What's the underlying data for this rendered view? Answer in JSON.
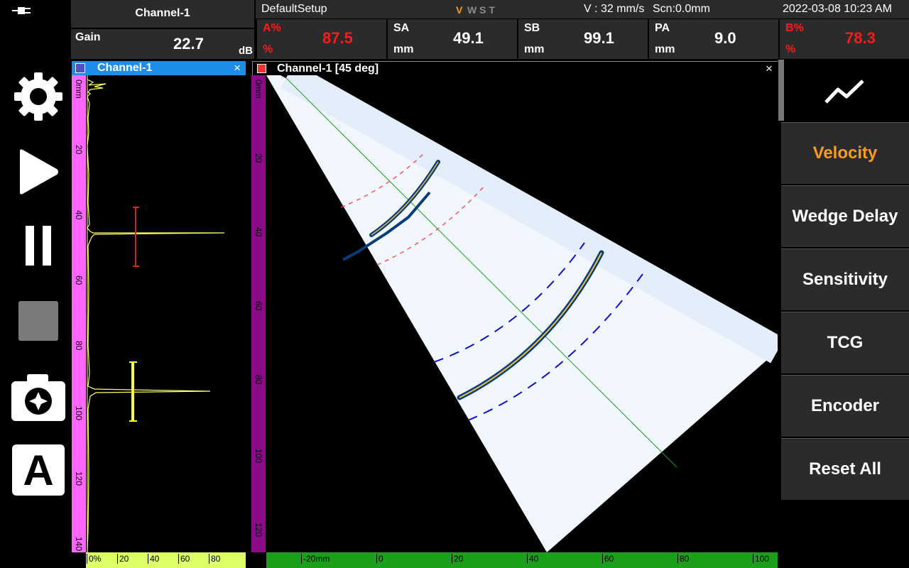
{
  "toolbar": {
    "items": [
      {
        "name": "settings",
        "icon": "gear-icon"
      },
      {
        "name": "play",
        "icon": "play-icon"
      },
      {
        "name": "pause",
        "icon": "pause-icon"
      },
      {
        "name": "stop",
        "icon": "stop-icon"
      },
      {
        "name": "capture",
        "icon": "camera-icon"
      },
      {
        "name": "auto",
        "icon": "auto-a-icon",
        "label": "A"
      }
    ]
  },
  "header": {
    "channel": "Channel-1",
    "gain_label": "Gain",
    "gain_value": "22.7",
    "gain_unit": "dB",
    "setup": "DefaultSetup",
    "modes": {
      "v": "V",
      "rest": "W S T"
    },
    "velocity": "V : 32 mm/s",
    "scan": "Scn:0.0mm",
    "datetime": "2022-03-08 10:23 AM",
    "readouts": [
      {
        "label": "A%",
        "unit": "%",
        "value": "87.5",
        "color": "#ff1a1a"
      },
      {
        "label": "SA",
        "unit": "mm",
        "value": "49.1",
        "color": "#ffffff"
      },
      {
        "label": "SB",
        "unit": "mm",
        "value": "99.1",
        "color": "#ffffff"
      },
      {
        "label": "PA",
        "unit": "mm",
        "value": "9.0",
        "color": "#ffffff"
      },
      {
        "label": "B%",
        "unit": "%",
        "value": "78.3",
        "color": "#ff1a1a"
      }
    ]
  },
  "ascan": {
    "title": "Channel-1",
    "close": "×",
    "depth_ticks": [
      "0mm",
      "20",
      "40",
      "60",
      "80",
      "100",
      "120",
      "140"
    ],
    "amp_ticks": [
      "0%",
      "20",
      "40",
      "60",
      "80"
    ]
  },
  "sscan": {
    "title": "Channel-1 [45 deg]",
    "close": "×",
    "depth_ticks": [
      "0mm",
      "20",
      "40",
      "60",
      "80",
      "100",
      "120"
    ],
    "x_ticks": [
      "-20mm",
      "0",
      "20",
      "40",
      "60",
      "80",
      "100"
    ]
  },
  "right_panel": {
    "graph_icon": "trend-line-icon",
    "buttons": [
      {
        "label": "Velocity",
        "color": "#ff9b1a"
      },
      {
        "label": "Wedge Delay",
        "color": "#ffffff"
      },
      {
        "label": "Sensitivity",
        "color": "#ffffff"
      },
      {
        "label": "TCG",
        "color": "#ffffff"
      },
      {
        "label": "Encoder",
        "color": "#ffffff"
      },
      {
        "label": "Reset All",
        "color": "#ffffff"
      }
    ]
  },
  "colors": {
    "accent": "#ff9b1a",
    "title_bar": "#1e8de8",
    "gate_a": "#e02020",
    "gate_b": "#ffff00",
    "depth_ruler_a": "#ff66ff",
    "depth_ruler_s": "#8a0a8a",
    "amp_ruler": "#ddff66",
    "x_ruler": "#1aa01a"
  }
}
